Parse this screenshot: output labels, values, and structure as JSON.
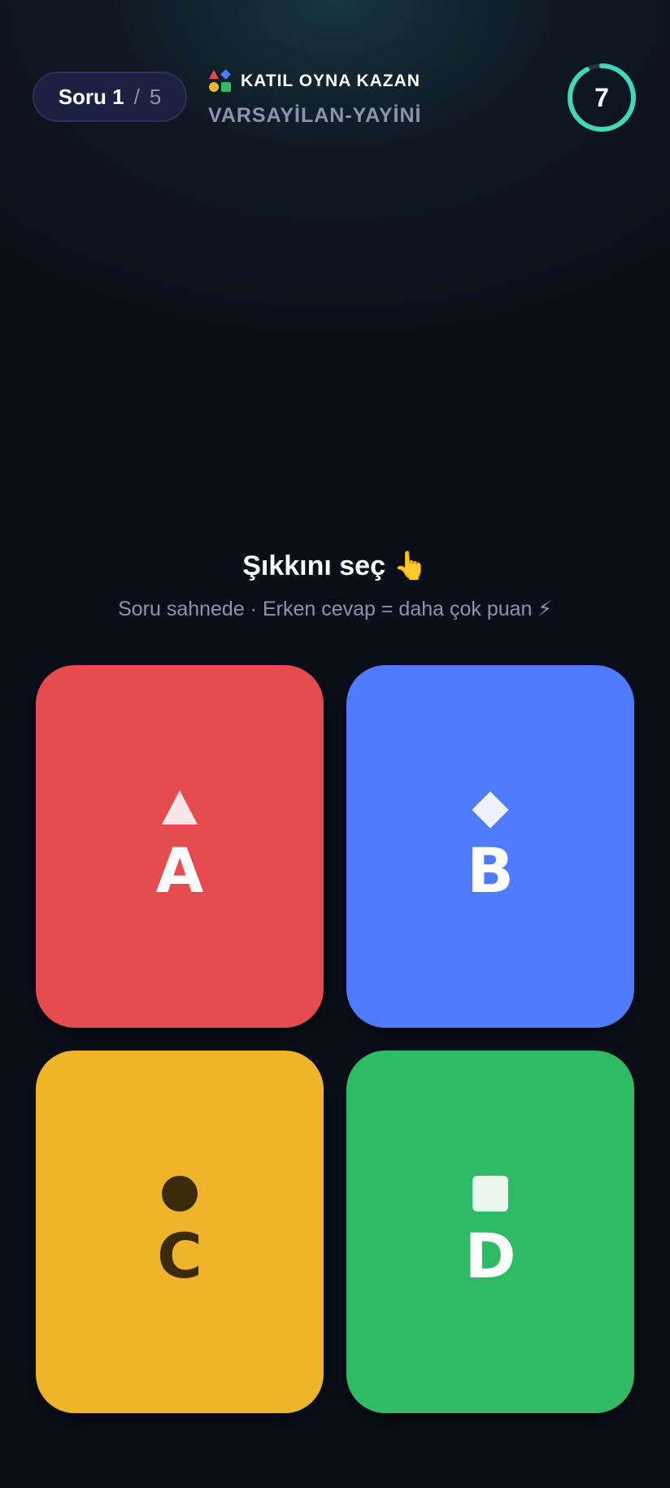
{
  "header": {
    "question_label": "Soru 1",
    "separator": "/",
    "question_total": "5",
    "brand_name": "KATIL OYNA KAZAN",
    "channel": "VARSAYİLAN-YAYİNİ",
    "timer": "7"
  },
  "prompt": {
    "title": "Şıkkını seç 👆",
    "subtitle": "Soru sahnede · Erken cevap = daha çok puan ⚡"
  },
  "answers": [
    {
      "letter": "A",
      "shape": "triangle",
      "color": "#e64b50"
    },
    {
      "letter": "B",
      "shape": "diamond",
      "color": "#4f7cff"
    },
    {
      "letter": "C",
      "shape": "circle",
      "color": "#efb42a"
    },
    {
      "letter": "D",
      "shape": "square",
      "color": "#2fba66"
    }
  ],
  "colors": {
    "background": "#0b0f1a",
    "timer_ring": "#3fd9b8",
    "timer_track": "#2a3245"
  }
}
